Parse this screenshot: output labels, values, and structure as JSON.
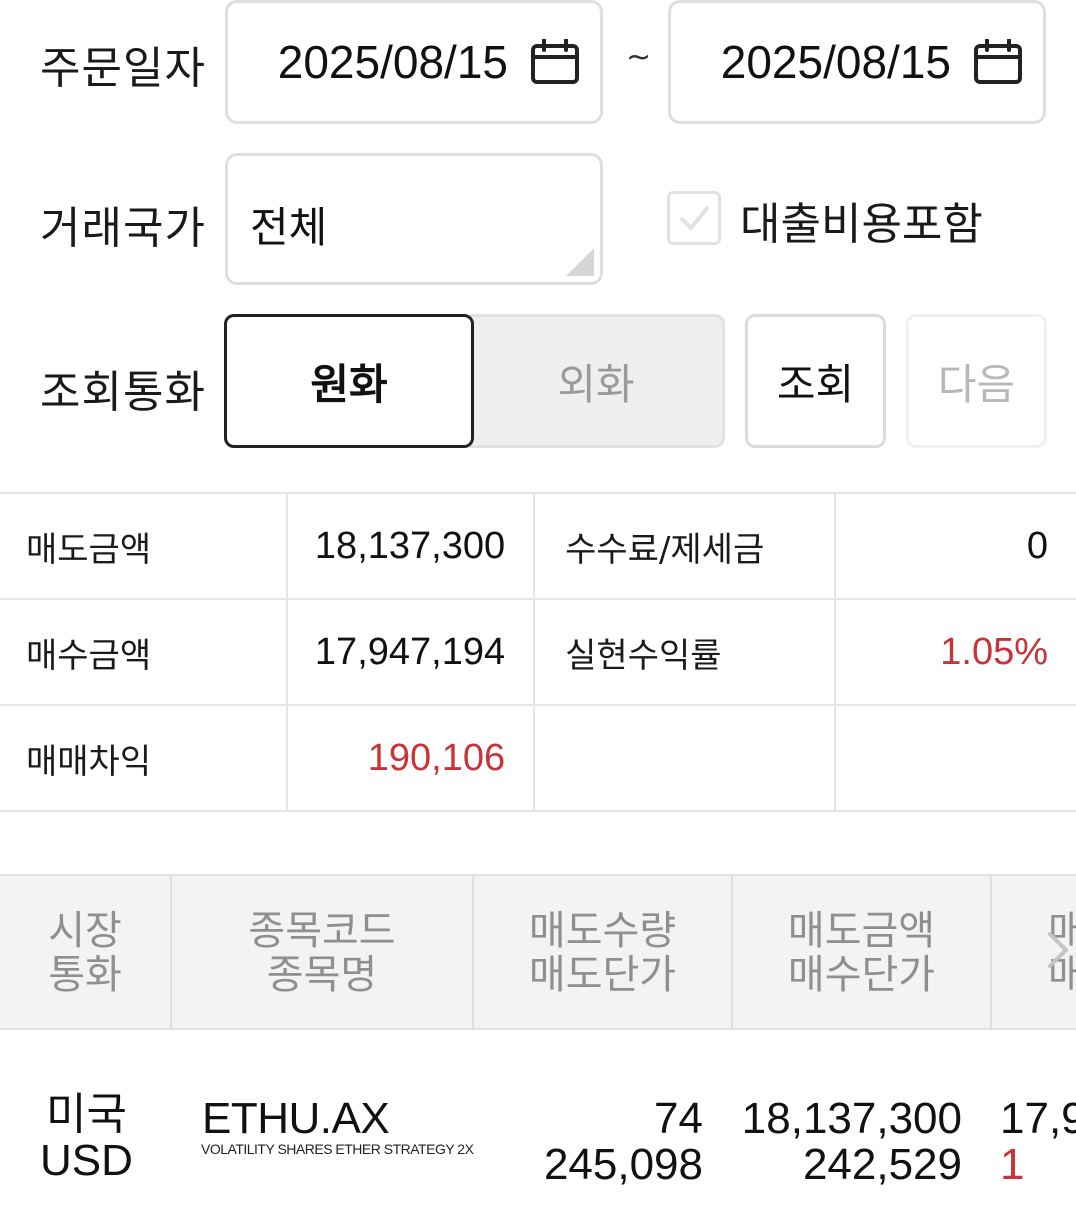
{
  "filters": {
    "order_date_label": "주문일자",
    "date_from": "2025/08/15",
    "date_to": "2025/08/15",
    "range_separator": "~",
    "country_label": "거래국가",
    "country_value": "전체",
    "include_loan_label": "대출비용포함",
    "include_loan_checked": false,
    "currency_label": "조회통화",
    "currency_options": [
      "원화",
      "외화"
    ],
    "currency_selected": "원화",
    "search_button": "조회",
    "next_button": "다음"
  },
  "summary": {
    "sell_amount_label": "매도금액",
    "sell_amount": "18,137,300",
    "fee_tax_label": "수수료/제세금",
    "fee_tax": "0",
    "buy_amount_label": "매수금액",
    "buy_amount": "17,947,194",
    "realized_return_label": "실현수익률",
    "realized_return": "1.05%",
    "trade_pnl_label": "매매차익",
    "trade_pnl": "190,106"
  },
  "grid": {
    "headers": [
      {
        "line1": "시장",
        "line2": "통화"
      },
      {
        "line1": "종목코드",
        "line2": "종목명"
      },
      {
        "line1": "매도수량",
        "line2": "매도단가"
      },
      {
        "line1": "매도금액",
        "line2": "매수단가"
      },
      {
        "line1": "매",
        "line2": "매"
      }
    ],
    "rows": [
      {
        "market": "미국",
        "currency": "USD",
        "code": "ETHU.AX",
        "name": "VOLATILITY SHARES ETHER STRATEGY 2X",
        "sell_qty": "74",
        "sell_price": "245,098",
        "sell_amount": "18,137,300",
        "buy_price": "242,529",
        "next_col_line1": "17,9",
        "next_col_line2": "1"
      }
    ]
  },
  "colors": {
    "positive_red": "#c8333a",
    "border": "#e6e6e6",
    "header_bg": "#f3f3f3",
    "disabled_text": "#9a9a9a"
  },
  "icons": {
    "date_picker": "calendar-icon",
    "checkbox": "checkmark-icon",
    "scroll_hint": "chevron-right-icon"
  }
}
